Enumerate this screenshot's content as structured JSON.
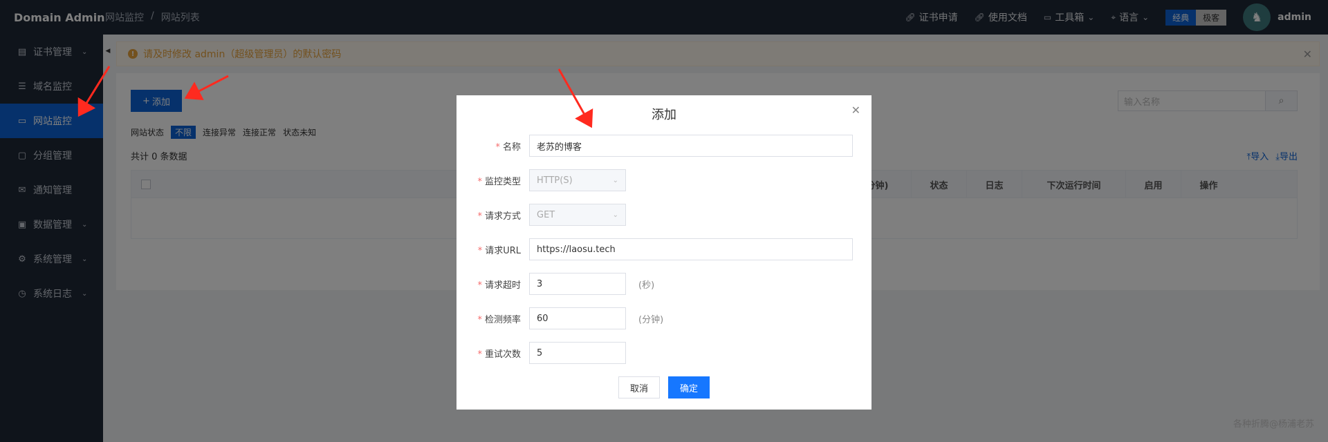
{
  "header": {
    "brand": "Domain Admin",
    "breadcrumb": [
      "网站监控",
      "/",
      "网站列表"
    ],
    "links": [
      {
        "icon": "link-icon",
        "label": "证书申请"
      },
      {
        "icon": "link-icon",
        "label": "使用文档"
      },
      {
        "icon": "toolbox-icon",
        "label": "工具箱"
      },
      {
        "icon": "location-icon",
        "label": "语言"
      }
    ],
    "theme_toggle": {
      "active": "经典",
      "inactive": "极客"
    },
    "user": "admin"
  },
  "sidebar": {
    "items": [
      {
        "label": "证书管理",
        "icon": "document-icon",
        "has_children": true
      },
      {
        "label": "域名监控",
        "icon": "database-icon",
        "has_children": false
      },
      {
        "label": "网站监控",
        "icon": "monitor-icon",
        "has_children": false,
        "active": true
      },
      {
        "label": "分组管理",
        "icon": "folder-icon",
        "has_children": false
      },
      {
        "label": "通知管理",
        "icon": "mail-icon",
        "has_children": false
      },
      {
        "label": "数据管理",
        "icon": "briefcase-icon",
        "has_children": true
      },
      {
        "label": "系统管理",
        "icon": "gear-icon",
        "has_children": true
      },
      {
        "label": "系统日志",
        "icon": "clock-icon",
        "has_children": true
      }
    ]
  },
  "alert": {
    "text": "请及时修改 admin（超级管理员）的默认密码"
  },
  "toolbar": {
    "add_label": "添加",
    "search_placeholder": "输入名称"
  },
  "filters": {
    "label": "网站状态",
    "options": [
      "不限",
      "连接异常",
      "连接正常",
      "状态未知"
    ],
    "selected": "不限"
  },
  "summary": {
    "total": "共计 0 条数据",
    "import": "导入",
    "export": "导出"
  },
  "table": {
    "columns": [
      "率(分钟)",
      "状态",
      "日志",
      "下次运行时间",
      "启用",
      "操作"
    ]
  },
  "modal": {
    "title": "添加",
    "fields": [
      {
        "label": "名称",
        "value": "老苏的博客",
        "type": "text"
      },
      {
        "label": "监控类型",
        "value": "HTTP(S)",
        "type": "select"
      },
      {
        "label": "请求方式",
        "value": "GET",
        "type": "select"
      },
      {
        "label": "请求URL",
        "value": "https://laosu.tech",
        "type": "text"
      },
      {
        "label": "请求超时",
        "value": "3",
        "type": "text",
        "unit": "(秒)"
      },
      {
        "label": "检测频率",
        "value": "60",
        "type": "text",
        "unit": "(分钟)"
      },
      {
        "label": "重试次数",
        "value": "5",
        "type": "text"
      }
    ],
    "cancel": "取消",
    "confirm": "确定"
  },
  "watermark": "各种折腾@杨浦老苏"
}
